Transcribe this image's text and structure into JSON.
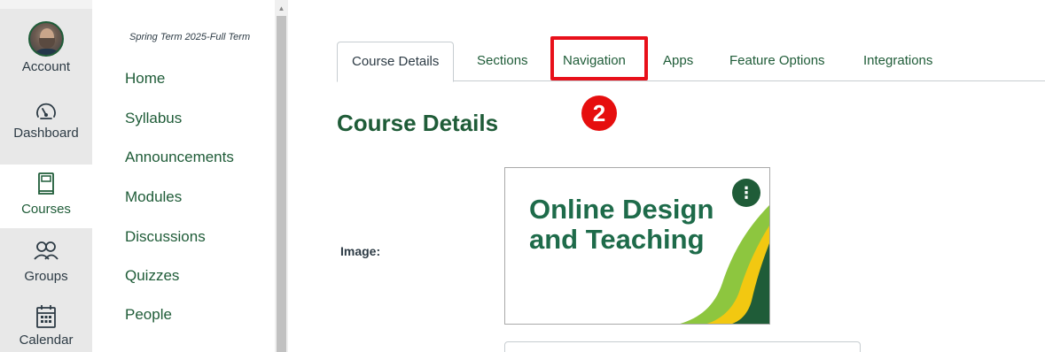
{
  "global_nav": {
    "items": [
      {
        "label": "Account",
        "icon": "avatar"
      },
      {
        "label": "Dashboard",
        "icon": "dashboard-icon"
      },
      {
        "label": "Courses",
        "icon": "courses-icon",
        "active": true
      },
      {
        "label": "Groups",
        "icon": "groups-icon"
      },
      {
        "label": "Calendar",
        "icon": "calendar-icon"
      }
    ]
  },
  "course_nav": {
    "term": "Spring Term 2025-Full Term",
    "links": [
      "Home",
      "Syllabus",
      "Announcements",
      "Modules",
      "Discussions",
      "Quizzes",
      "People"
    ]
  },
  "tabs": [
    "Course Details",
    "Sections",
    "Navigation",
    "Apps",
    "Feature Options",
    "Integrations"
  ],
  "annotation": {
    "step_number": "2",
    "color": "#e8101a"
  },
  "main": {
    "title": "Course Details",
    "image_label": "Image:",
    "image_text_line1": "Online Design",
    "image_text_line2": "and Teaching",
    "kebab_label": "⋮"
  },
  "colors": {
    "brand_green": "#1f5c38",
    "nav_bg": "#e8e8e8",
    "highlight_red": "#e8101a"
  }
}
